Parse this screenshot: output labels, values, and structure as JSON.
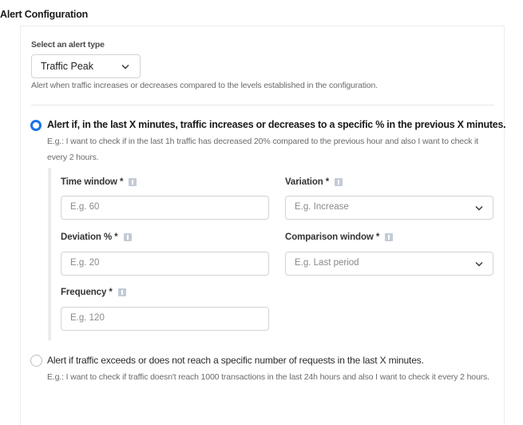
{
  "section": {
    "title": "Alert Configuration"
  },
  "alert_type": {
    "label": "Select an alert type",
    "selected": "Traffic Peak",
    "helper": "Alert when traffic increases or decreases compared to the levels established in the configuration."
  },
  "options": [
    {
      "selected": true,
      "title": "Alert if, in the last X minutes, traffic increases or decreases to a specific % in the previous X minutes.",
      "example": "E.g.: I want to check if in the last 1h traffic has decreased 20% compared to the previous hour and also I want to check it every 2 hours."
    },
    {
      "selected": false,
      "title": "Alert if traffic exceeds or does not reach a specific number of requests in the last X minutes.",
      "example": "E.g.: I want to check if traffic doesn't reach 1000 transactions in the last 24h hours and also I want to check it every 2 hours."
    }
  ],
  "fields": {
    "time_window": {
      "label": "Time window *",
      "placeholder": "E.g. 60",
      "icon": "info-icon"
    },
    "variation": {
      "label": "Variation *",
      "placeholder": "E.g. Increase",
      "icon": "info-icon",
      "type": "dropdown"
    },
    "deviation": {
      "label": "Deviation % *",
      "placeholder": "E.g. 20",
      "icon": "info-icon"
    },
    "comparison_window": {
      "label": "Comparison window *",
      "placeholder": "E.g. Last period",
      "icon": "info-icon",
      "type": "dropdown"
    },
    "frequency": {
      "label": "Frequency *",
      "placeholder": "E.g. 120",
      "icon": "info-icon"
    }
  },
  "colors": {
    "accent": "#1a73e8",
    "info_icon": "#c3cbd6"
  }
}
